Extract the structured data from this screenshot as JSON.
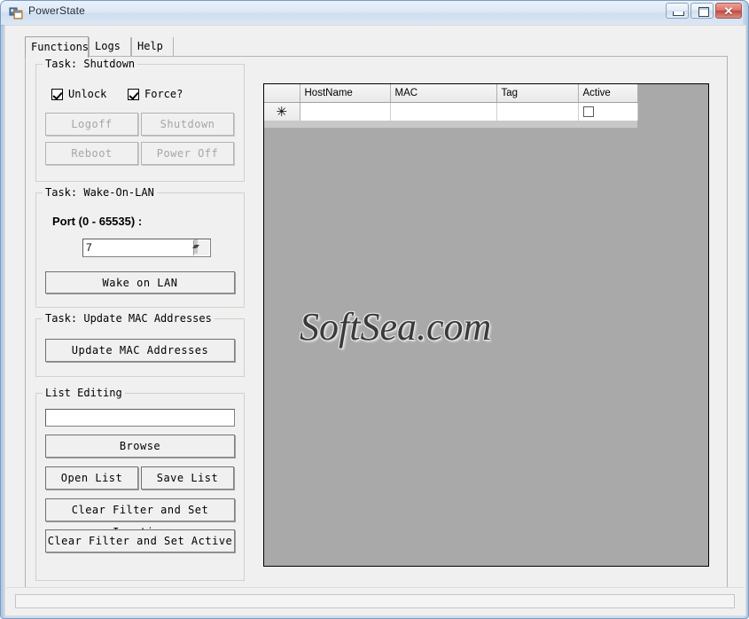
{
  "window": {
    "title": "PowerState",
    "icon": "app-form-icon",
    "controls": {
      "minimize": "minimize-icon",
      "maximize": "maximize-icon",
      "close": "✕"
    }
  },
  "tabs": [
    {
      "label": "Functions",
      "active": true
    },
    {
      "label": "Logs",
      "active": false
    },
    {
      "label": "Help",
      "active": false
    }
  ],
  "shutdown_group": {
    "title": "Task: Shutdown",
    "checkboxes": [
      {
        "label": "Unlock",
        "checked": true
      },
      {
        "label": "Force?",
        "checked": true
      }
    ],
    "buttons": [
      {
        "label": "Logoff",
        "disabled": true
      },
      {
        "label": "Shutdown",
        "disabled": true
      },
      {
        "label": "Reboot",
        "disabled": true
      },
      {
        "label": "Power Off",
        "disabled": true
      }
    ]
  },
  "wol_group": {
    "title": "Task: Wake-On-LAN",
    "port_label": "Port (0 - 65535) :",
    "port_value": "7",
    "button_label": "Wake on LAN"
  },
  "mac_group": {
    "title": "Task: Update MAC Addresses",
    "button_label": "Update MAC Addresses"
  },
  "list_group": {
    "title": "List Editing",
    "path_value": "",
    "path_placeholder": "",
    "buttons": [
      {
        "label": "Browse"
      },
      {
        "label": "Open List"
      },
      {
        "label": "Save List"
      },
      {
        "label": "Clear Filter and Set Inactive"
      },
      {
        "label": "Clear Filter and Set Active"
      }
    ]
  },
  "grid": {
    "columns": [
      "HostName",
      "MAC",
      "Tag",
      "Active"
    ],
    "row_header_new": "✳",
    "rows": [
      {
        "HostName": "",
        "MAC": "",
        "Tag": "",
        "Active": false
      }
    ]
  },
  "watermark": "SoftSea.com",
  "statusbar": {
    "text": ""
  },
  "colors": {
    "frame": "#adc5e0",
    "client": "#f0f0f0",
    "grid_backdrop": "#a9a9a9",
    "close_button": "#c0483e",
    "disabled_text": "#a6a6a6"
  }
}
